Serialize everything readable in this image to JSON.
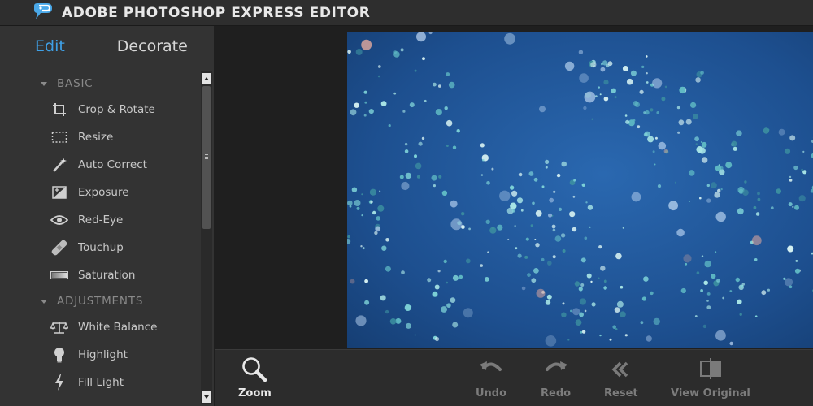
{
  "app": {
    "title": "ADOBE PHOTOSHOP EXPRESS EDITOR"
  },
  "mode_tabs": [
    {
      "label": "Edit",
      "active": true
    },
    {
      "label": "Decorate",
      "active": false
    }
  ],
  "sections": [
    {
      "title": "BASIC",
      "items": [
        {
          "label": "Crop & Rotate",
          "icon": "crop-icon"
        },
        {
          "label": "Resize",
          "icon": "resize-icon"
        },
        {
          "label": "Auto Correct",
          "icon": "magic-wand-icon"
        },
        {
          "label": "Exposure",
          "icon": "exposure-icon"
        },
        {
          "label": "Red-Eye",
          "icon": "eye-icon"
        },
        {
          "label": "Touchup",
          "icon": "bandage-icon"
        },
        {
          "label": "Saturation",
          "icon": "saturation-icon"
        }
      ]
    },
    {
      "title": "ADJUSTMENTS",
      "items": [
        {
          "label": "White Balance",
          "icon": "balance-scale-icon"
        },
        {
          "label": "Highlight",
          "icon": "lightbulb-icon"
        },
        {
          "label": "Fill Light",
          "icon": "lightning-icon"
        }
      ]
    }
  ],
  "toolbar": {
    "zoom": "Zoom",
    "undo": "Undo",
    "redo": "Redo",
    "reset": "Reset",
    "view_original": "View Original"
  },
  "colors": {
    "accent": "#3fa0e6",
    "photo_background": "#1d4f8f"
  }
}
